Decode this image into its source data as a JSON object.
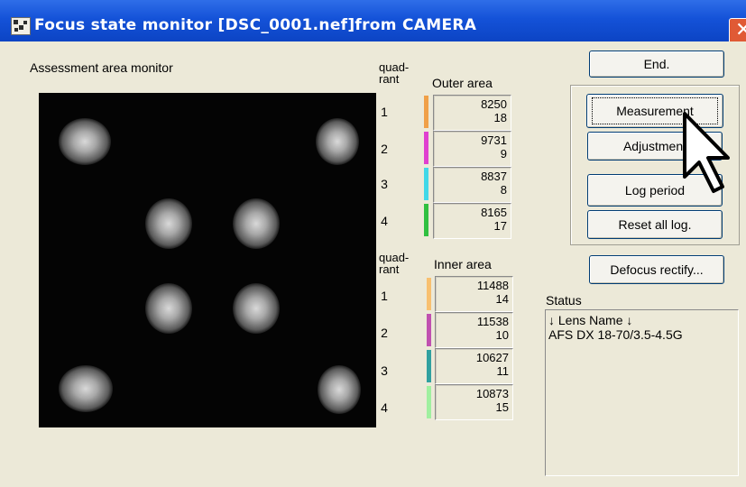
{
  "window": {
    "title": "Focus state monitor [DSC_0001.nef]from CAMERA",
    "close_label": "✕"
  },
  "monitor": {
    "label": "Assessment area monitor"
  },
  "outer": {
    "quadrant_header_1": "quad-",
    "quadrant_header_2": "rant",
    "label": "Outer area",
    "rows": [
      {
        "q": "1",
        "value": "8250",
        "sub": "18",
        "color": "#f0a048"
      },
      {
        "q": "2",
        "value": "9731",
        "sub": "9",
        "color": "#e040d0"
      },
      {
        "q": "3",
        "value": "8837",
        "sub": "8",
        "color": "#40d8e8"
      },
      {
        "q": "4",
        "value": "8165",
        "sub": "17",
        "color": "#30c040"
      }
    ]
  },
  "inner": {
    "quadrant_header_1": "quad-",
    "quadrant_header_2": "rant",
    "label": "Inner area",
    "rows": [
      {
        "q": "1",
        "value": "11488",
        "sub": "14",
        "color": "#f8c070"
      },
      {
        "q": "2",
        "value": "11538",
        "sub": "10",
        "color": "#c050b0"
      },
      {
        "q": "3",
        "value": "10627",
        "sub": "11",
        "color": "#30a0a0"
      },
      {
        "q": "4",
        "value": "10873",
        "sub": "15",
        "color": "#a0f0a0"
      }
    ]
  },
  "buttons": {
    "end": "End.",
    "measurement": "Measurement",
    "adjustment": "Adjustment",
    "log_period": "Log period",
    "reset_all_log": "Reset all log.",
    "defocus_rectify": "Defocus rectify..."
  },
  "status": {
    "label": "Status",
    "line1": "↓ Lens Name ↓",
    "line2": "AFS DX 18-70/3.5-4.5G"
  },
  "colors": {
    "titlebar": "#1452d8",
    "close": "#e05a35",
    "window_bg": "#ece9d8",
    "monitor_bg": "#040404"
  }
}
